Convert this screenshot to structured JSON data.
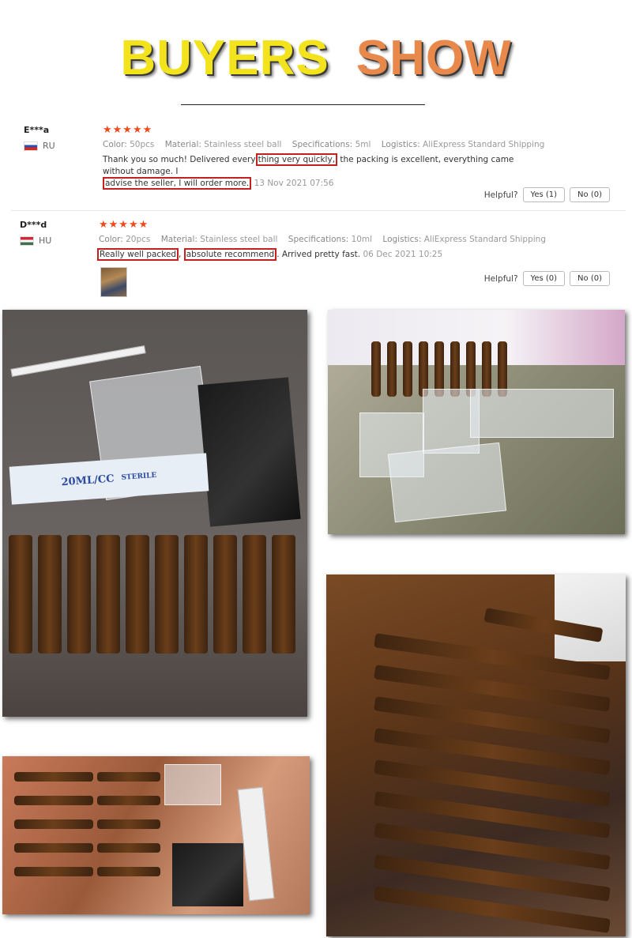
{
  "banner": {
    "word1": "BUYERS",
    "word2": "SHOW"
  },
  "reviews": [
    {
      "user": "E***a",
      "country": "RU",
      "stars": "★★★★★",
      "meta": [
        {
          "k": "Color:",
          "v": "50pcs"
        },
        {
          "k": "Material:",
          "v": "Stainless steel ball"
        },
        {
          "k": "Specifications:",
          "v": "5ml"
        },
        {
          "k": "Logistics:",
          "v": "AliExpress Standard Shipping"
        }
      ],
      "text_parts": [
        "Thank you so much! Delivered every",
        "thing very quickly,",
        " the packing is excellent, everything came without damage. I",
        "advise the seller, I will order more.",
        " "
      ],
      "date": "13 Nov 2021 07:56",
      "helpful_label": "Helpful?",
      "yes": "Yes (1)",
      "no": "No (0)"
    },
    {
      "user": "D***d",
      "country": "HU",
      "stars": "★★★★★",
      "meta": [
        {
          "k": "Color:",
          "v": "20pcs"
        },
        {
          "k": "Material:",
          "v": "Stainless steel ball"
        },
        {
          "k": "Specifications:",
          "v": "10ml"
        },
        {
          "k": "Logistics:",
          "v": "AliExpress Standard Shipping"
        }
      ],
      "text_parts": [
        "Really well packed",
        ", ",
        "absolute recommend",
        ". Arrived pretty fast."
      ],
      "date": "06 Dec 2021 10:25",
      "helpful_label": "Helpful?",
      "yes": "Yes (0)",
      "no": "No (0)"
    }
  ],
  "photo_labels": {
    "syringe_text": "20ML/CC",
    "sterile": "STERILE"
  },
  "colors": {
    "star": "#f04a1c",
    "highlight_box": "#c42020",
    "banner_yellow": "#f3e31c",
    "banner_orange": "#e8884a"
  }
}
